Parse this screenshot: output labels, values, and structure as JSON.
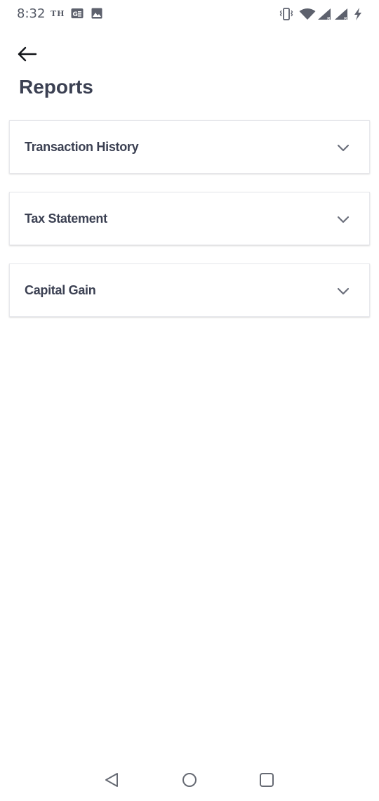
{
  "status_bar": {
    "time": "8:32",
    "carrier": "TH",
    "icons": [
      "gallery-notification-icon",
      "image-notification-icon",
      "vibrate-icon",
      "wifi-icon",
      "signal-icon",
      "signal-icon",
      "battery-charging-icon"
    ]
  },
  "header": {
    "back_icon": "arrow-left-icon",
    "title": "Reports"
  },
  "reports": [
    {
      "label": "Transaction History",
      "icon": "chevron-down-icon"
    },
    {
      "label": "Tax Statement",
      "icon": "chevron-down-icon"
    },
    {
      "label": "Capital Gain",
      "icon": "chevron-down-icon"
    }
  ],
  "nav_bar": {
    "buttons": [
      "back-triangle-icon",
      "home-circle-icon",
      "recents-square-icon"
    ]
  },
  "colors": {
    "text_primary": "#3b4052",
    "card_border": "#e7e8ec",
    "icon_gray": "#6b6f7b"
  }
}
